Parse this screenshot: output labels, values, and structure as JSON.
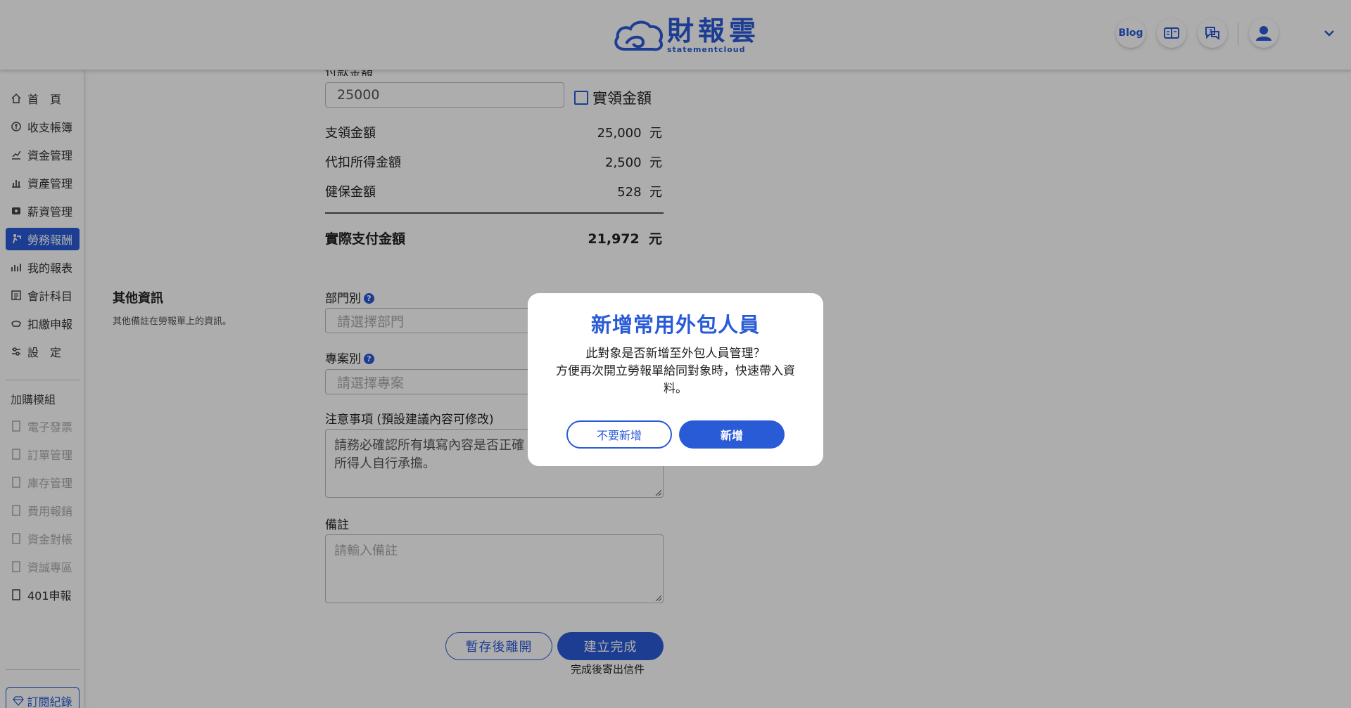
{
  "header": {
    "logo_cn": "財報雲",
    "logo_en": "statementcloud",
    "blog_label": "Blog"
  },
  "sidebar": {
    "items": [
      {
        "label": "首　頁",
        "icon": "home-icon"
      },
      {
        "label": "收支帳簿",
        "icon": "ledger-icon"
      },
      {
        "label": "資金管理",
        "icon": "funds-icon"
      },
      {
        "label": "資產管理",
        "icon": "assets-icon"
      },
      {
        "label": "薪資管理",
        "icon": "payroll-icon"
      },
      {
        "label": "勞務報酬",
        "icon": "labor-icon"
      },
      {
        "label": "我的報表",
        "icon": "report-icon"
      },
      {
        "label": "會計科目",
        "icon": "accounts-icon"
      },
      {
        "label": "扣繳申報",
        "icon": "withholding-icon"
      },
      {
        "label": "設　定",
        "icon": "settings-icon"
      }
    ],
    "addon_section": "加購模組",
    "addons": [
      {
        "label": "電子發票"
      },
      {
        "label": "訂單管理"
      },
      {
        "label": "庫存管理"
      },
      {
        "label": "費用報銷"
      },
      {
        "label": "資金對帳"
      },
      {
        "label": "資誠專區"
      },
      {
        "label": "401申報"
      }
    ],
    "subscription_label": "訂閱紀錄"
  },
  "form": {
    "payment_label_partial": "付款金額",
    "payment_value": "25000",
    "actual_checkbox_label": "實領金額",
    "rows": [
      {
        "label": "支領金額",
        "value": "25,000",
        "unit": "元"
      },
      {
        "label": "代扣所得金額",
        "value": "2,500",
        "unit": "元"
      },
      {
        "label": "健保金額",
        "value": "528",
        "unit": "元"
      }
    ],
    "total_label": "實際支付金額",
    "total_value": "21,972",
    "total_unit": "元",
    "other_info_title": "其他資訊",
    "other_info_desc": "其他備註在勞報單上的資訊。",
    "department_label": "部門別",
    "department_placeholder": "請選擇部門",
    "project_label": "專案別",
    "project_placeholder": "請選擇專案",
    "notes_label": "注意事項 (預設建議內容可修改)",
    "notes_value": "請務必確認所有填寫內容是否正確",
    "notes_value2": "所得人自行承擔。",
    "remark_label": "備註",
    "remark_placeholder": "請輸入備註",
    "save_draft_label": "暫存後離開",
    "complete_label": "建立完成",
    "complete_hint": "完成後寄出信件"
  },
  "modal": {
    "title": "新增常用外包人員",
    "line1": "此對象是否新增至外包人員管理？",
    "line2": "方便再次開立勞報單給同對象時，快速帶入資料。",
    "cancel_label": "不要新增",
    "confirm_label": "新增"
  },
  "colors": {
    "accent": "#2a5bd7"
  }
}
